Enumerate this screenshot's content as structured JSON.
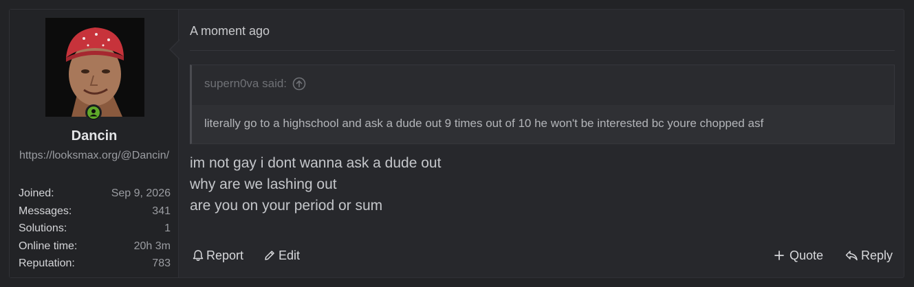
{
  "user": {
    "name": "Dancin",
    "url": "https://looksmax.org/@Dancin/",
    "stats": [
      {
        "label": "Joined:",
        "value": "Sep 9, 2026"
      },
      {
        "label": "Messages:",
        "value": "341"
      },
      {
        "label": "Solutions:",
        "value": "1"
      },
      {
        "label": "Online time:",
        "value": "20h 3m"
      },
      {
        "label": "Reputation:",
        "value": "783"
      }
    ]
  },
  "post": {
    "timestamp": "A moment ago",
    "quote": {
      "author_line": "supern0va said:",
      "text": "literally go to a highschool and ask a dude out 9 times out of 10 he won't be interested bc youre chopped asf"
    },
    "lines": [
      "im not gay i dont wanna ask a dude out",
      "why are we lashing out",
      "are you on your period or sum"
    ]
  },
  "actions": {
    "report": "Report",
    "edit": "Edit",
    "quote": "Quote",
    "reply": "Reply"
  },
  "icons": {
    "online": "user-online-icon",
    "jump": "arrow-up-circle-icon",
    "report": "bell-icon",
    "edit": "pencil-icon",
    "quote": "plus-icon",
    "reply": "reply-icon"
  },
  "colors": {
    "online_green": "#5fa82a",
    "background": "#27282c"
  }
}
